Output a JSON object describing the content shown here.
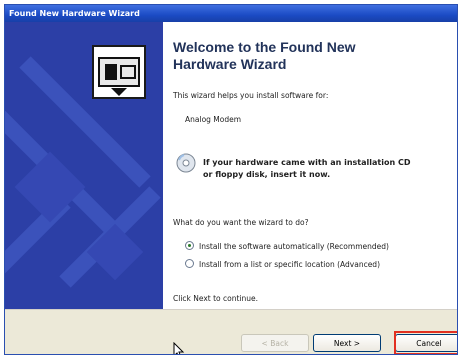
{
  "window": {
    "title": "Found New Hardware Wizard"
  },
  "wizard": {
    "heading": "Welcome to the Found New\nHardware Wizard",
    "intro": "This wizard helps you install software for:",
    "device": "Analog Modem",
    "cd_notice": "If your hardware came with an installation CD\nor floppy disk, insert it now.",
    "question": "What do you want the wizard to do?",
    "options": [
      {
        "label": "Install the software automatically (Recommended)",
        "selected": true
      },
      {
        "label": "Install from a list or specific location (Advanced)",
        "selected": false
      }
    ],
    "continue_text": "Click Next to continue."
  },
  "buttons": {
    "back": "< Back",
    "next": "Next >",
    "cancel": "Cancel"
  },
  "colors": {
    "title_bar": "#1b4bc4",
    "left_panel": "#2c3fa6",
    "highlight": "#e23020"
  }
}
